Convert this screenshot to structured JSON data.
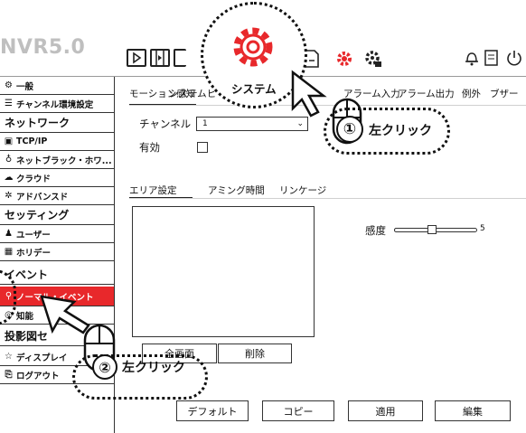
{
  "logo": "NVR5.0",
  "topbar": {
    "icons": [
      "playback-icon",
      "video-clip-icon",
      "export-icon",
      "system-gear-icon",
      "record-icon",
      "red-gear-icon",
      "config-gear-icon",
      "alarm-bell-icon",
      "log-icon",
      "power-icon"
    ]
  },
  "sidebar": {
    "items": [
      {
        "label": "一般",
        "icon": "gear-icon",
        "type": "item"
      },
      {
        "label": "チャンネル環境設定",
        "icon": "sliders-icon",
        "type": "item"
      },
      {
        "label": "ネットワーク",
        "type": "header"
      },
      {
        "label": "TCP/IP",
        "icon": "network-icon",
        "type": "item"
      },
      {
        "label": "ネットブラック・ホワ...",
        "icon": "filter-icon",
        "type": "item"
      },
      {
        "label": "クラウド",
        "icon": "cloud-icon",
        "type": "item"
      },
      {
        "label": "アドバンスド",
        "icon": "advanced-gear-icon",
        "type": "item"
      },
      {
        "label": "セッティング",
        "type": "header"
      },
      {
        "label": "ユーザー",
        "icon": "users-icon",
        "type": "item"
      },
      {
        "label": "ホリデー",
        "icon": "calendar-icon",
        "type": "item"
      },
      {
        "label": "イベント",
        "type": "header"
      },
      {
        "label": "ノーマル・イベント",
        "icon": "event-icon",
        "type": "item",
        "active": true
      },
      {
        "label": "知能",
        "icon": "intelligence-icon",
        "type": "item"
      },
      {
        "label": "投影図セ",
        "type": "header"
      },
      {
        "label": "ディスプレイ",
        "icon": "star-icon",
        "type": "item"
      },
      {
        "label": "ログアウト",
        "icon": "logout-icon",
        "type": "item"
      }
    ]
  },
  "tabs": [
    "モーション感知",
    "ビ",
    "システム",
    "ア",
    "アラーム入力",
    "アラーム出力",
    "例外",
    "ブザー"
  ],
  "form": {
    "channel_label": "チャンネル",
    "channel_value": "1",
    "enable_label": "有効"
  },
  "subtabs": [
    "エリア設定",
    "アミング時間",
    "リンケージ"
  ],
  "sensitivity": {
    "label": "感度",
    "value": "5",
    "level": 0.45
  },
  "buttons": {
    "fullscreen": "全画面",
    "delete": "削除",
    "default": "デフォルト",
    "copy": "コピー",
    "apply": "適用",
    "edit": "編集"
  },
  "annotations": {
    "system_label": "システム",
    "step1_num": "①",
    "step1_text": "左クリック",
    "step2_num": "②",
    "step2_text": "左クリック"
  },
  "colors": {
    "accent": "#e8282b",
    "logo": "#bfbfbf",
    "text": "#111111"
  }
}
